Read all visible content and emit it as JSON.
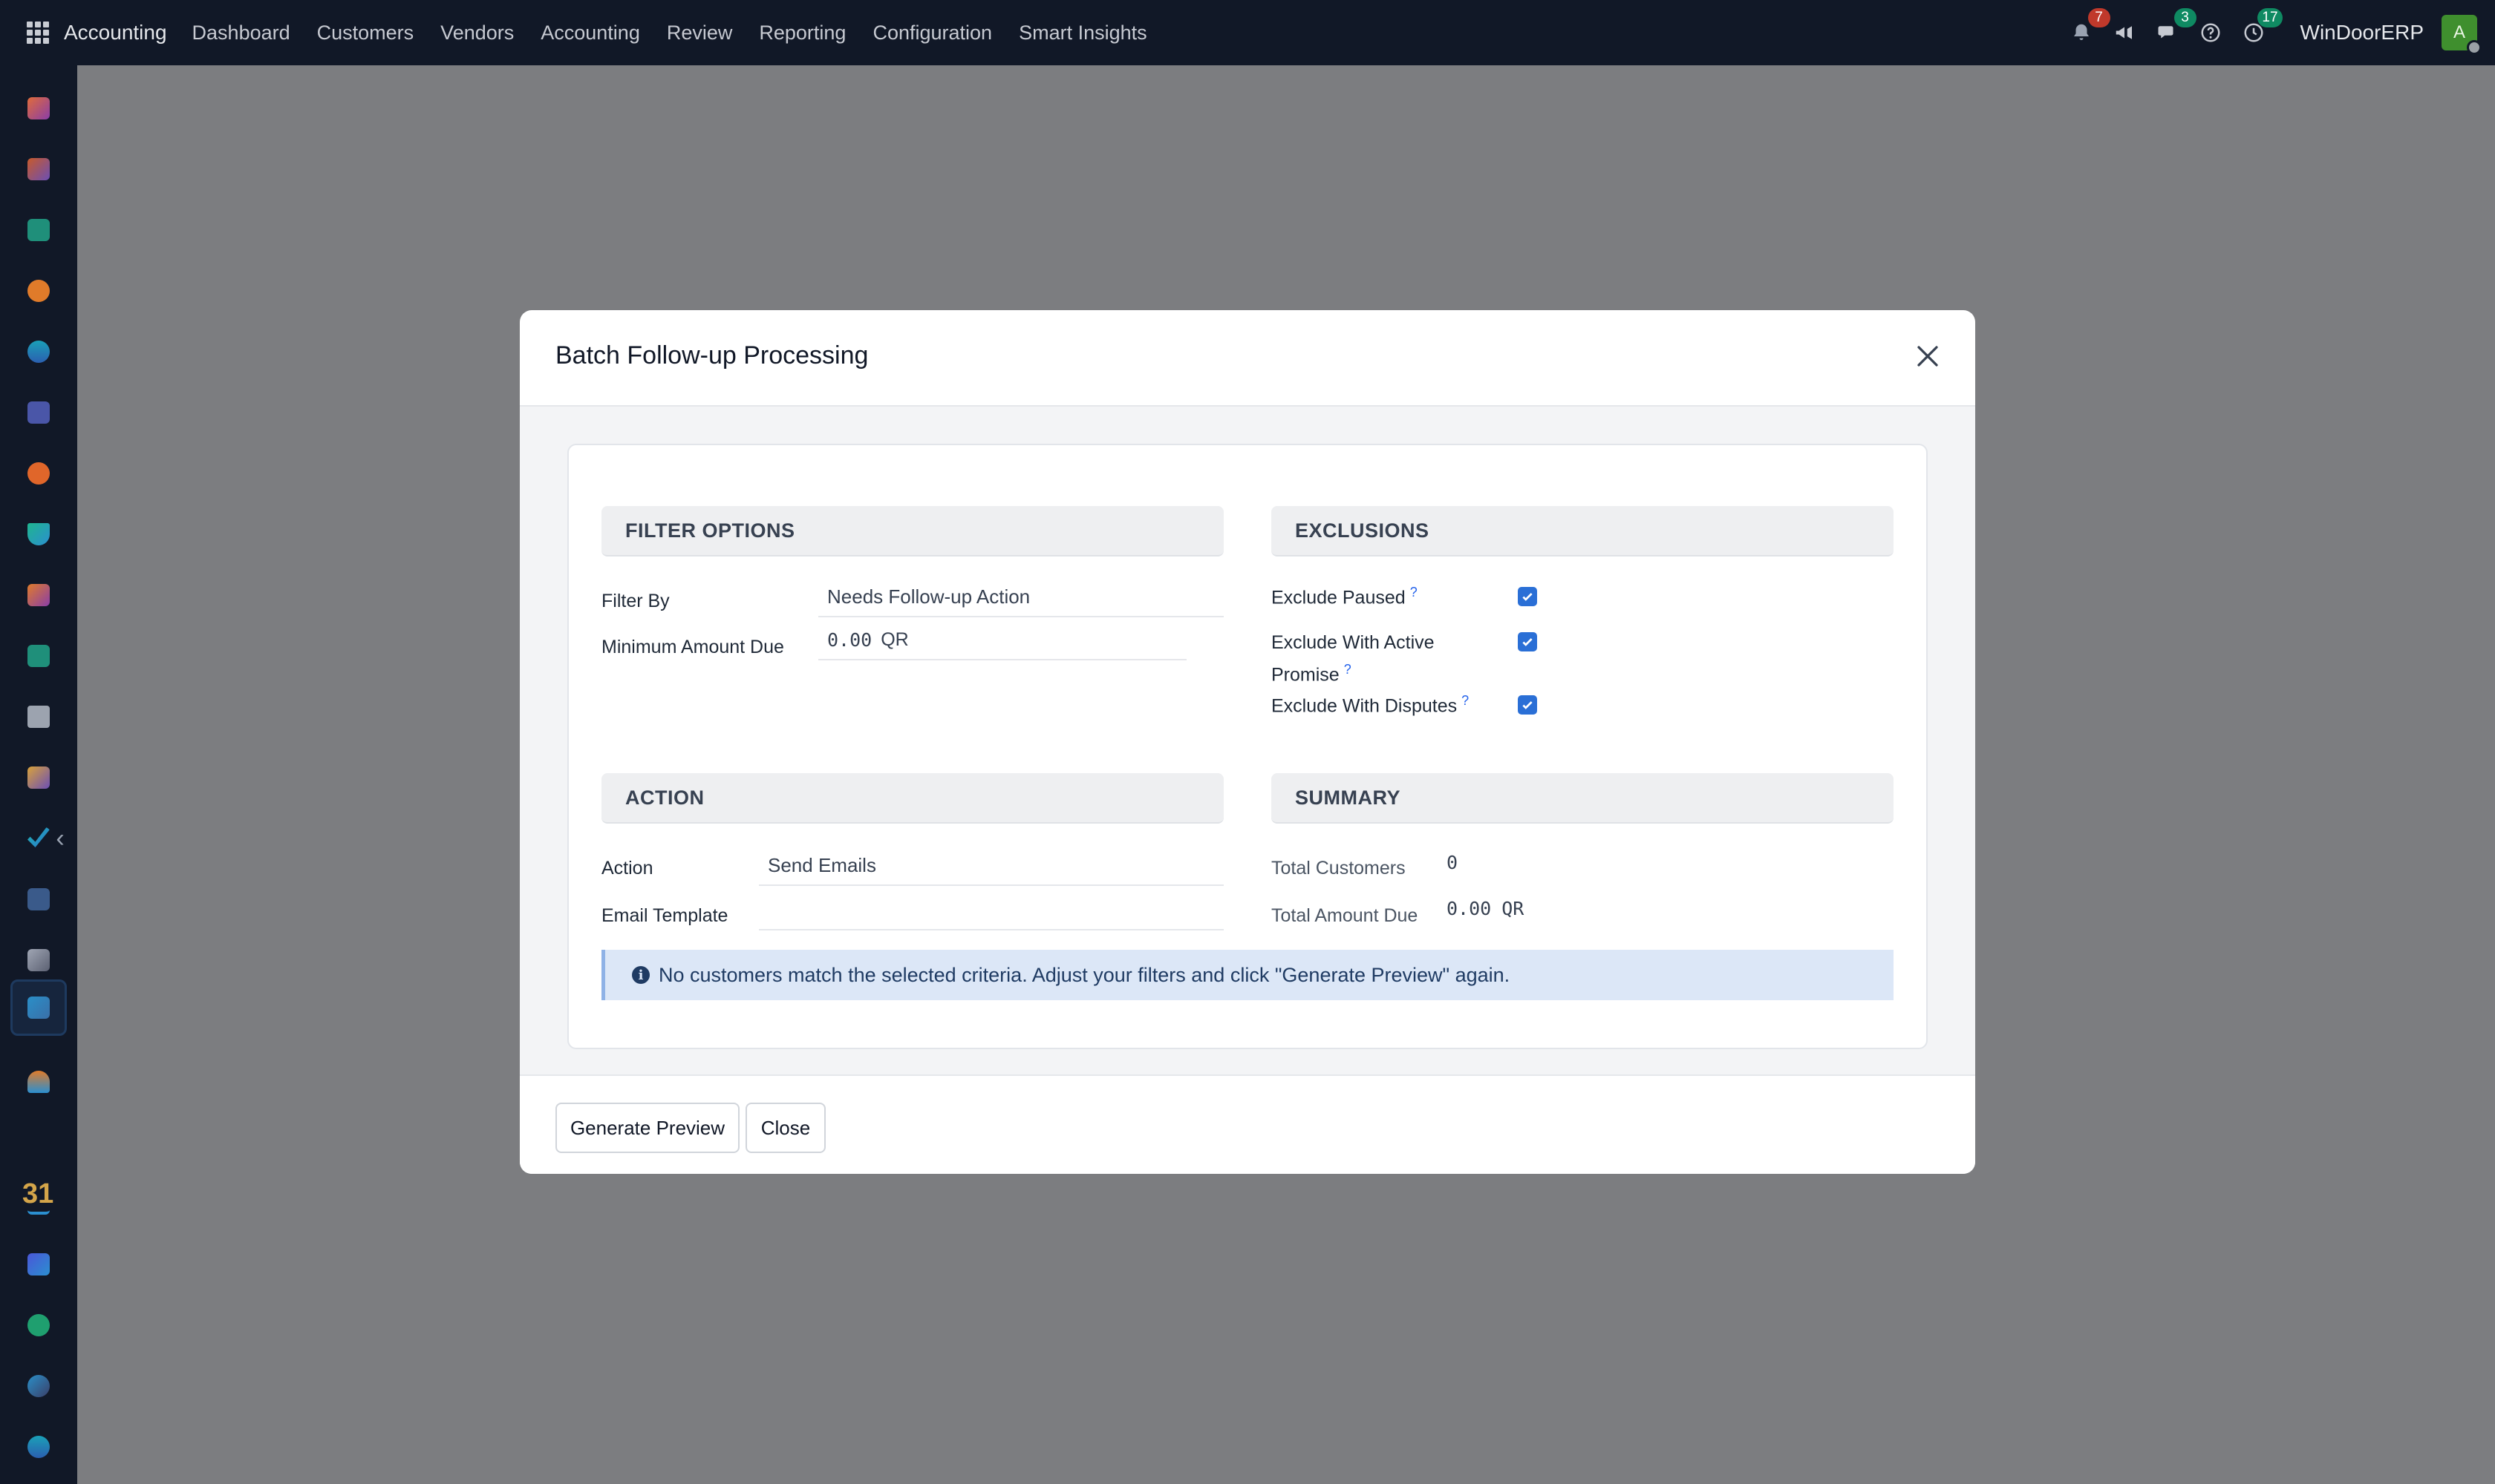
{
  "topbar": {
    "app_name": "Accounting",
    "menu": [
      "Dashboard",
      "Customers",
      "Vendors",
      "Accounting",
      "Review",
      "Reporting",
      "Configuration",
      "Smart Insights"
    ],
    "notifications_count": "7",
    "messages_count": "3",
    "activities_count": "17",
    "company": "WinDoorERP",
    "avatar_initial": "A"
  },
  "modal": {
    "title": "Batch Follow-up Processing",
    "filter_section": {
      "heading": "FILTER OPTIONS",
      "filter_by_label": "Filter By",
      "filter_by_value": "Needs Follow-up Action",
      "min_amount_label": "Minimum Amount Due",
      "min_amount_value": "0.00",
      "min_amount_currency": "QR"
    },
    "exclusions_section": {
      "heading": "EXCLUSIONS",
      "exclude_paused_label": "Exclude Paused",
      "exclude_paused_checked": true,
      "exclude_promise_label_line1": "Exclude With Active",
      "exclude_promise_label_line2": "Promise",
      "exclude_promise_checked": true,
      "exclude_disputes_label": "Exclude With Disputes",
      "exclude_disputes_checked": true,
      "help_mark": "?"
    },
    "action_section": {
      "heading": "ACTION",
      "action_label": "Action",
      "action_value": "Send Emails",
      "email_template_label": "Email Template",
      "email_template_value": ""
    },
    "summary_section": {
      "heading": "SUMMARY",
      "total_customers_label": "Total Customers",
      "total_customers_value": "0",
      "total_amount_label": "Total Amount Due",
      "total_amount_value": "0.00",
      "total_amount_currency": "QR"
    },
    "alert_text": "No customers match the selected criteria. Adjust your filters and click \"Generate Preview\" again.",
    "footer": {
      "generate_label": "Generate Preview",
      "close_label": "Close"
    }
  },
  "colors": {
    "navbar_bg": "#111827",
    "backdrop": "#7c7d80",
    "checkbox": "#2a6fd6",
    "alert_bg": "#dce7f7"
  }
}
